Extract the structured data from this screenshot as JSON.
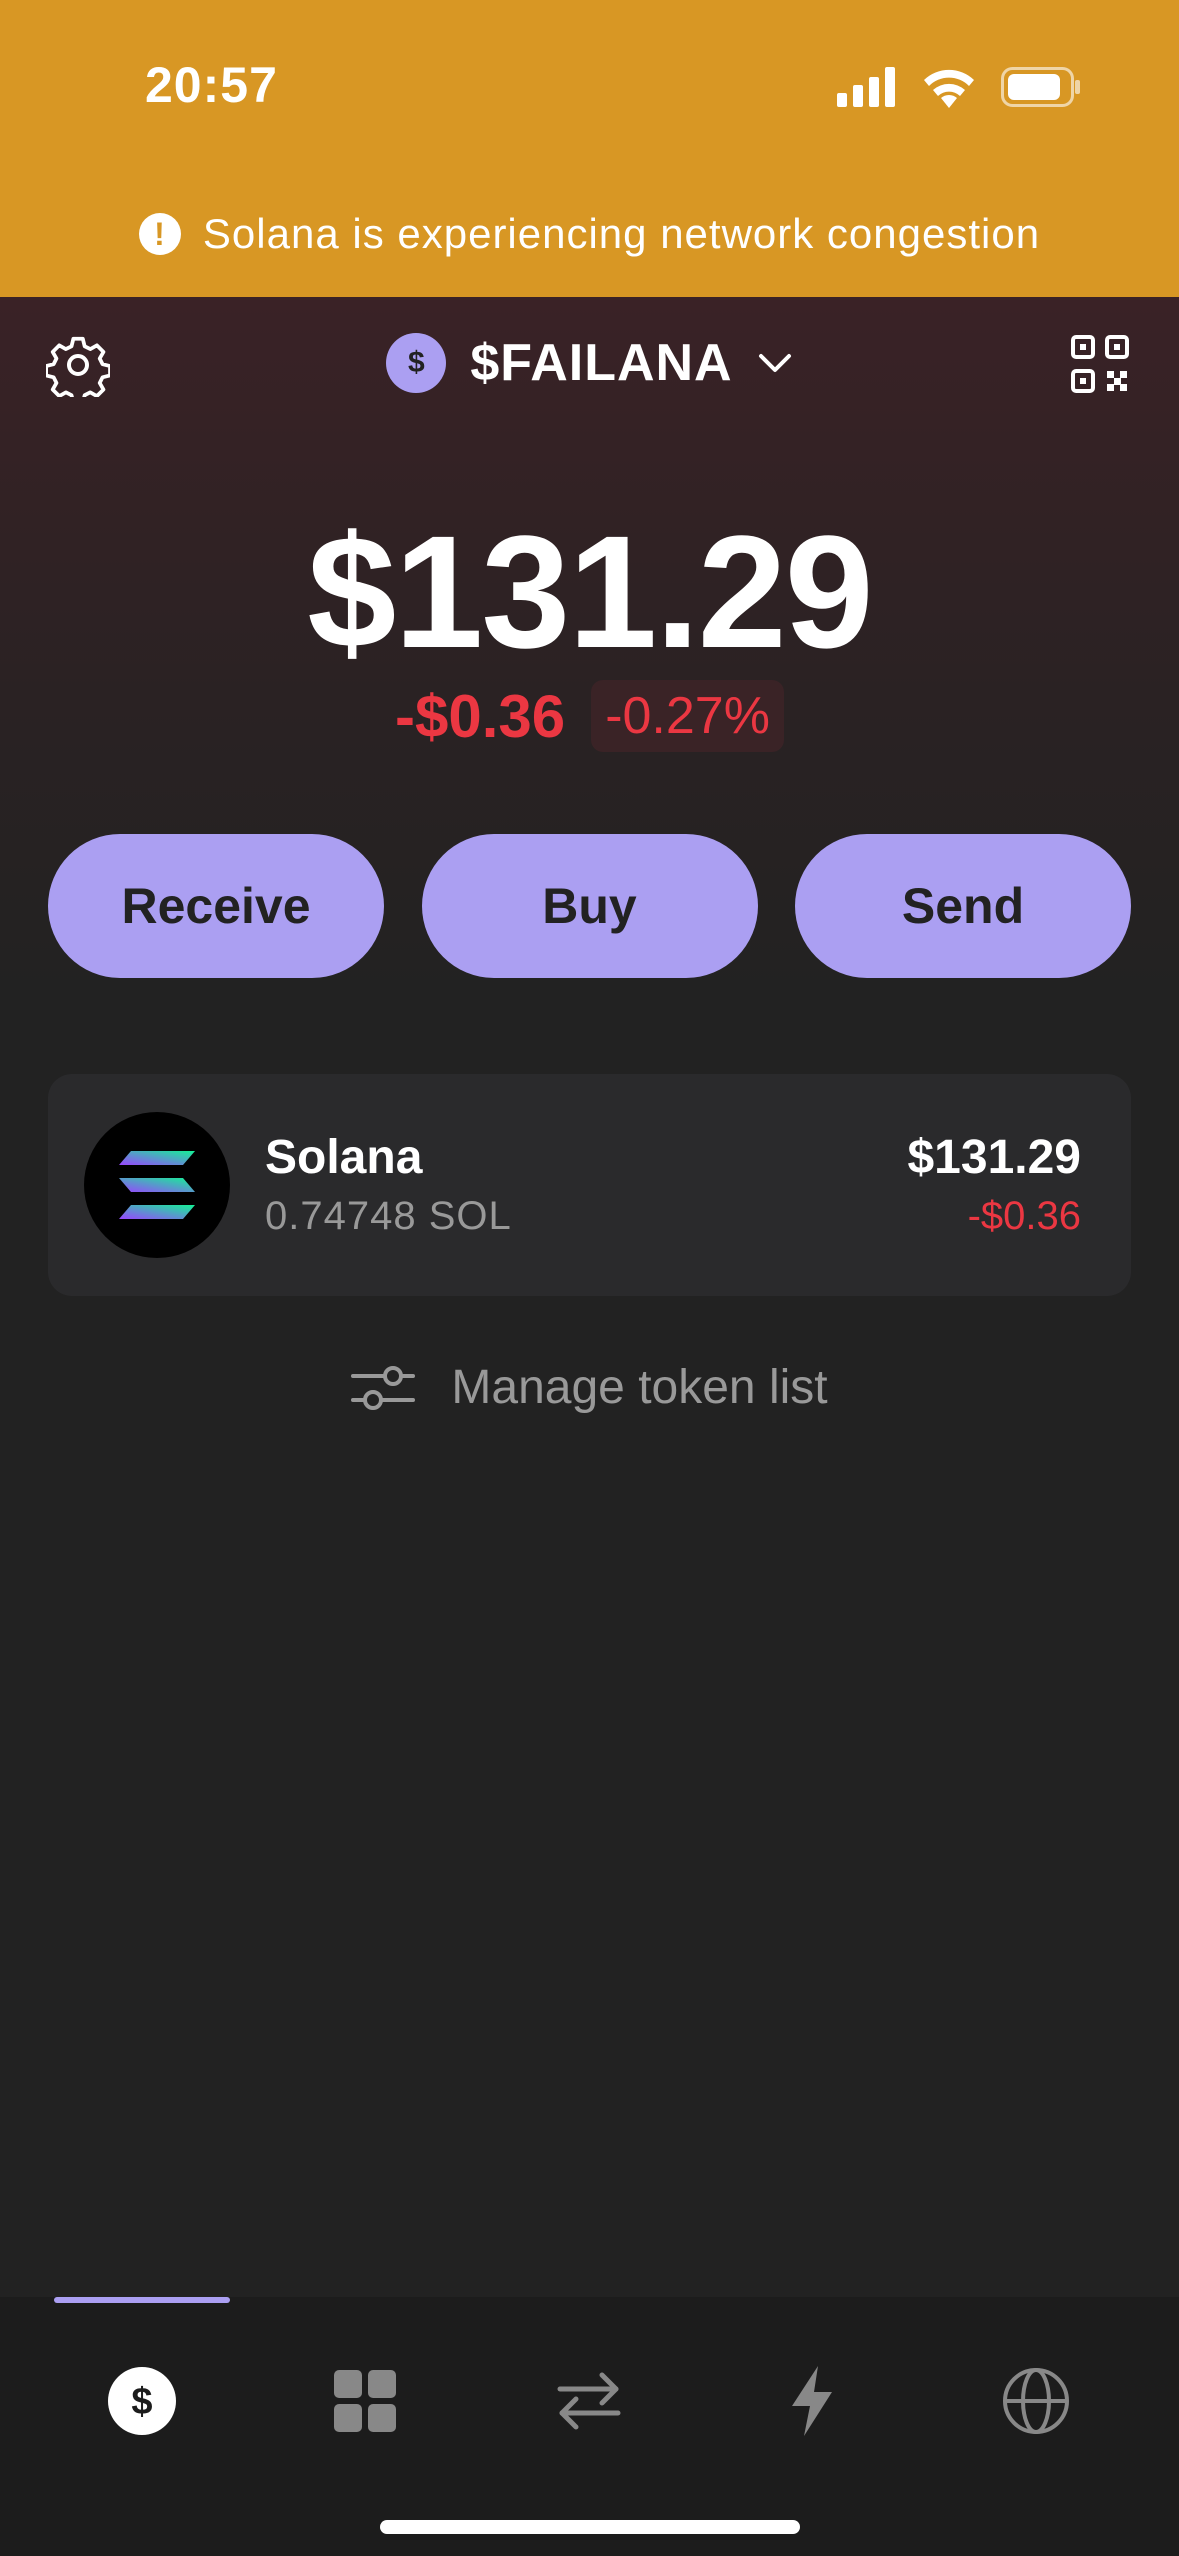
{
  "status_bar": {
    "time": "20:57"
  },
  "banner": {
    "message": "Solana is experiencing network congestion",
    "color": "#d89724"
  },
  "header": {
    "account_avatar_symbol": "$",
    "account_name": "$FAILANA"
  },
  "portfolio": {
    "balance": "$131.29",
    "change_abs": "-$0.36",
    "change_pct": "-0.27%"
  },
  "actions": {
    "receive_label": "Receive",
    "buy_label": "Buy",
    "send_label": "Send"
  },
  "tokens": [
    {
      "name": "Solana",
      "amount": "0.74748 SOL",
      "value": "$131.29",
      "change": "-$0.36"
    }
  ],
  "manage_label": "Manage token list",
  "nav": {
    "items": [
      "dollar-icon",
      "grid-icon",
      "swap-icon",
      "lightning-icon",
      "globe-icon"
    ],
    "active_index": 0
  },
  "colors": {
    "accent": "#ab9ff2",
    "negative": "#eb3742",
    "background": "#222222"
  }
}
